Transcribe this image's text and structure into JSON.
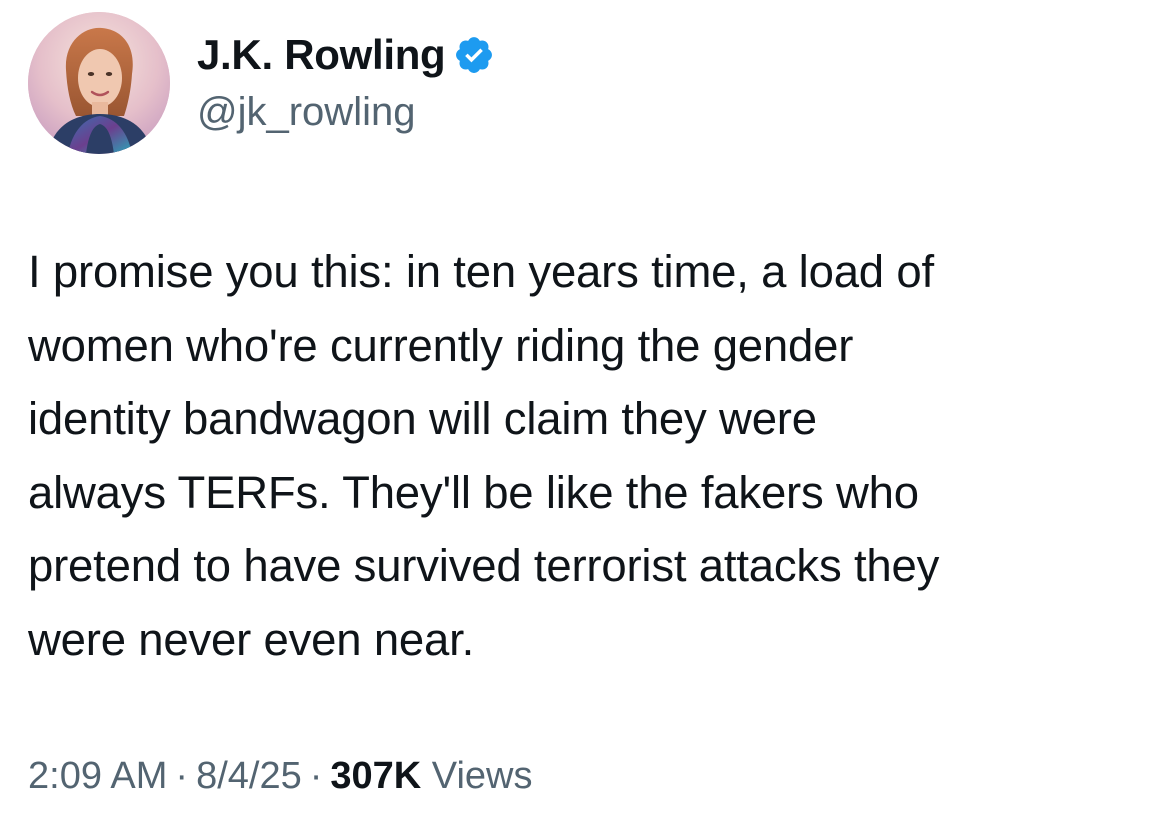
{
  "author": {
    "display_name": "J.K. Rowling",
    "handle": "@jk_rowling",
    "verified": true,
    "verified_icon": "verified-badge-icon",
    "verified_color": "#1d9bf0"
  },
  "tweet": {
    "lines": [
      "I promise you this: in ten years time, a load of",
      "women who're currently riding the gender",
      "identity bandwagon will claim they were",
      "always TERFs. They'll be like the fakers who",
      "pretend to have survived terrorist attacks they",
      "were never even near."
    ]
  },
  "meta": {
    "time": "2:09 AM",
    "separator": "·",
    "date": "8/4/25",
    "views_count": "307K",
    "views_label": "Views"
  },
  "colors": {
    "text_primary": "#0f1419",
    "text_secondary": "#536471",
    "background": "#ffffff"
  }
}
